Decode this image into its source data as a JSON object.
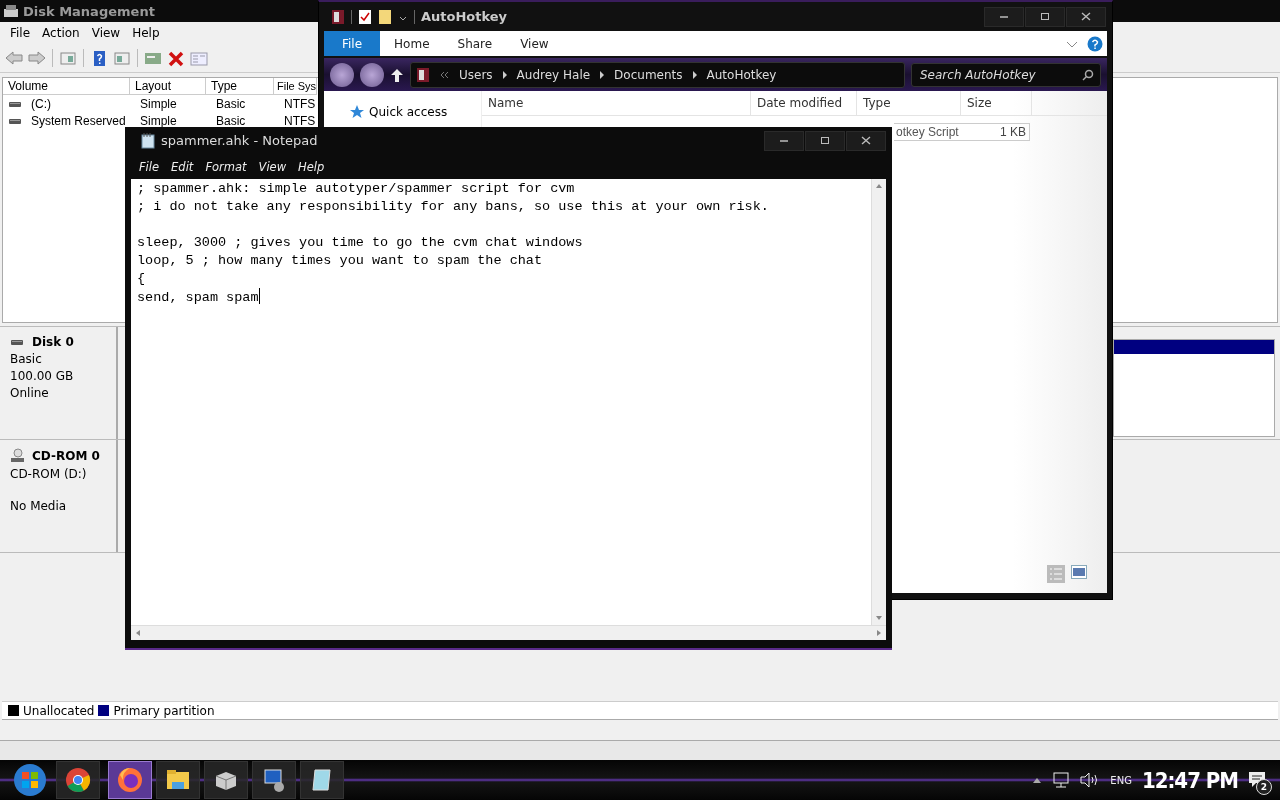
{
  "disk_management": {
    "title": "Disk Management",
    "menu": [
      "File",
      "Action",
      "View",
      "Help"
    ],
    "volume_columns": [
      "Volume",
      "Layout",
      "Type",
      "File Sys"
    ],
    "volumes": [
      {
        "cells": [
          "(C:)",
          "Simple",
          "Basic",
          "NTFS"
        ]
      },
      {
        "cells": [
          "System Reserved",
          "Simple",
          "Basic",
          "NTFS"
        ]
      }
    ],
    "disks": [
      {
        "kind": "disk",
        "name": "Disk 0",
        "details": [
          "Basic",
          "100.00 GB",
          "Online"
        ],
        "partitions": [
          {
            "kind": "primary"
          }
        ]
      },
      {
        "kind": "cdrom",
        "name": "CD-ROM 0",
        "details": [
          "CD-ROM (D:)",
          "No Media"
        ]
      }
    ],
    "legend": [
      {
        "label": "Unallocated",
        "color": "#000000"
      },
      {
        "label": "Primary partition",
        "color": "#000080"
      }
    ]
  },
  "explorer": {
    "title": "AutoHotkey",
    "tabs": [
      {
        "label": "File",
        "selected": true
      },
      {
        "label": "Home",
        "selected": false
      },
      {
        "label": "Share",
        "selected": false
      },
      {
        "label": "View",
        "selected": false
      }
    ],
    "breadcrumbs": [
      "Users",
      "Audrey Hale",
      "Documents",
      "AutoHotkey"
    ],
    "search": {
      "placeholder": "Search AutoHotkey"
    },
    "columns": [
      "Name",
      "Date modified",
      "Type",
      "Size"
    ],
    "nav_items": [
      "Quick access"
    ],
    "files": [
      {
        "type": "otkey Script",
        "size": "1 KB"
      }
    ]
  },
  "notepad": {
    "title": "spammer.ahk - Notepad",
    "menu": [
      "File",
      "Edit",
      "Format",
      "View",
      "Help"
    ],
    "content": "; spammer.ahk: simple autotyper/spammer script for cvm\n; i do not take any responsibility for any bans, so use this at your own risk.\n\nsleep, 3000 ; gives you time to go the cvm chat windows\nloop, 5 ; how many times you want to spam the chat\n{\nsend, spam spam"
  },
  "taskbar": {
    "apps": [
      {
        "kind": "chrome",
        "selected": false
      },
      {
        "kind": "firefox",
        "selected": true
      },
      {
        "kind": "folder",
        "selected": false
      },
      {
        "kind": "box",
        "selected": false
      },
      {
        "kind": "monitor",
        "selected": false
      },
      {
        "kind": "notepad",
        "selected": false
      }
    ],
    "language": "ENG",
    "time": "12:47 PM",
    "notifications": "2"
  }
}
